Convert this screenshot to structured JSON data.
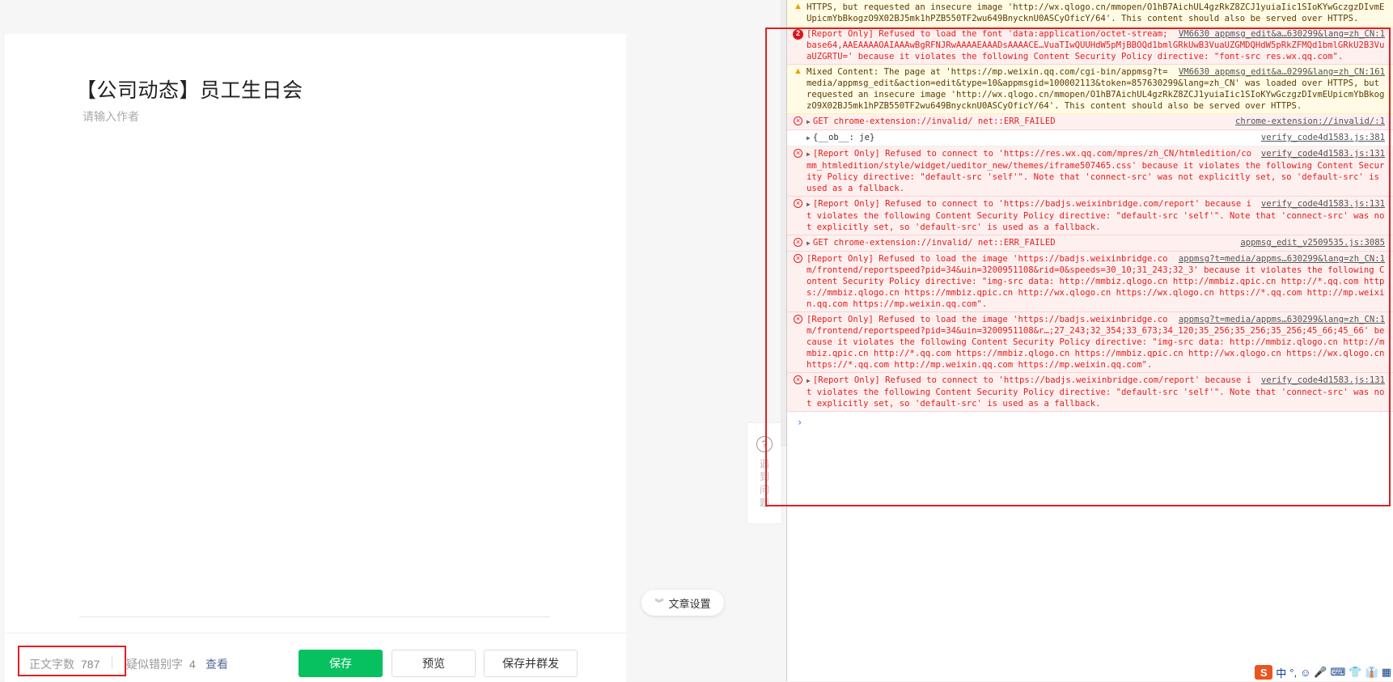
{
  "editor": {
    "title": "【公司动态】员工生日会",
    "author_placeholder": "请输入作者",
    "settings_label": "文章设置",
    "help_label": "遇到问题"
  },
  "bottom_bar": {
    "wordcount_label": "正文字数",
    "wordcount_value": "787",
    "typo_label": "疑似错别字",
    "typo_value": "4",
    "typo_view": "查看",
    "save_label": "保存",
    "preview_label": "预览",
    "publish_label": "保存并群发"
  },
  "console": {
    "messages": [
      {
        "type": "warn",
        "text": "HTTPS, but requested an insecure image 'http://wx.qlogo.cn/mmopen/O1hB7AichUL4gzRkZ8ZCJ1yuiaIic1SIoKYwGczgzDIvmEUpicmYbBkogzO9X02BJ5mk1hPZB550TF2wu649BnycknU0ASCyOficY/64'. This content should also be served over HTTPS.",
        "source": ""
      },
      {
        "type": "error",
        "badge": "2",
        "text": "[Report Only] Refused to load the font 'data:application/octet-stream;base64,AAEAAAAOAIAAAwBgRFNJRwAAAAEAAADsAAAACE…VuaTIwQUUHdW5pMjBBOQd1bmlGRkUwB3VuaUZGMDQHdW5pRkZFMQd1bmlGRkU2B3VuaUZGRTU=' because it violates the following Content Security Policy directive: \"font-src res.wx.qq.com\".",
        "source": "VM6630 appmsg_edit&a…630299&lang=zh_CN:1"
      },
      {
        "type": "warn",
        "text": "Mixed Content: The page at 'https://mp.weixin.qq.com/cgi-bin/appmsg?t=media/appmsg_edit&action=edit&type=10&appmsgid=100002113&token=857630299&lang=zh_CN' was loaded over HTTPS, but requested an insecure image 'http://wx.qlogo.cn/mmopen/O1hB7AichUL4gzRkZ8ZCJ1yuiaIic1SIoKYwGczgzDIvmEUpicmYbBkogzO9X02BJ5mk1hPZB550TF2wu649BnycknU0ASCyOficY/64'. This content should also be served over HTTPS.",
        "source": "VM6630 appmsg_edit&a…0299&lang=zh_CN:161"
      },
      {
        "type": "error",
        "arrow": true,
        "text": "GET chrome-extension://invalid/ net::ERR_FAILED",
        "source": "chrome-extension://invalid/:1"
      },
      {
        "type": "plain",
        "arrow": true,
        "text": "{__ob__: je}",
        "source": "verify_code4d1583.js:381"
      },
      {
        "type": "error",
        "arrow": true,
        "text": "[Report Only] Refused to connect to 'https://res.wx.qq.com/mpres/zh_CN/htmledition/comm_htmledition/style/widget/ueditor_new/themes/iframe507465.css' because it violates the following Content Security Policy directive: \"default-src 'self'\". Note that 'connect-src' was not explicitly set, so 'default-src' is used as a fallback.",
        "source": "verify_code4d1583.js:131"
      },
      {
        "type": "error",
        "arrow": true,
        "text": "[Report Only] Refused to connect to 'https://badjs.weixinbridge.com/report' because it violates the following Content Security Policy directive: \"default-src 'self'\". Note that 'connect-src' was not explicitly set, so 'default-src' is used as a fallback.",
        "source": "verify_code4d1583.js:131"
      },
      {
        "type": "error",
        "arrow": true,
        "text": "GET chrome-extension://invalid/ net::ERR_FAILED",
        "source": "appmsg_edit_v2509535.js:3085"
      },
      {
        "type": "error",
        "text": "[Report Only] Refused to load the image 'https://badjs.weixinbridge.com/frontend/reportspeed?pid=34&uin=3200951108&rid=0&speeds=30_10;31_243;32_3' because it violates the following Content Security Policy directive: \"img-src data: http://mmbiz.qlogo.cn http://mmbiz.qpic.cn http://*.qq.com https://mmbiz.qlogo.cn https://mmbiz.qpic.cn http://wx.qlogo.cn https://wx.qlogo.cn https://*.qq.com http://mp.weixin.qq.com https://mp.weixin.qq.com\".",
        "source": "appmsg?t=media/appms…630299&lang=zh_CN:1"
      },
      {
        "type": "error",
        "text": "[Report Only] Refused to load the image 'https://badjs.weixinbridge.com/frontend/reportspeed?pid=34&uin=3200951108&r…;27_243;32_354;33_673;34_120;35_256;35_256;35_256;45_66;45_66' because it violates the following Content Security Policy directive: \"img-src data: http://mmbiz.qlogo.cn http://mmbiz.qpic.cn http://*.qq.com https://mmbiz.qlogo.cn https://mmbiz.qpic.cn http://wx.qlogo.cn https://wx.qlogo.cn https://*.qq.com http://mp.weixin.qq.com https://mp.weixin.qq.com\".",
        "source": "appmsg?t=media/appms…630299&lang=zh_CN:1"
      },
      {
        "type": "error",
        "arrow": true,
        "text": "[Report Only] Refused to connect to 'https://badjs.weixinbridge.com/report' because it violates the following Content Security Policy directive: \"default-src 'self'\". Note that 'connect-src' was not explicitly set, so 'default-src' is used as a fallback.",
        "source": "verify_code4d1583.js:131"
      }
    ],
    "prompt": "›"
  },
  "tray": {
    "ime_logo": "S",
    "ime_mode": "中",
    "punct": "°,",
    "items": [
      "☺",
      "🎤",
      "⌨",
      "👕",
      "👔",
      "▦"
    ]
  }
}
